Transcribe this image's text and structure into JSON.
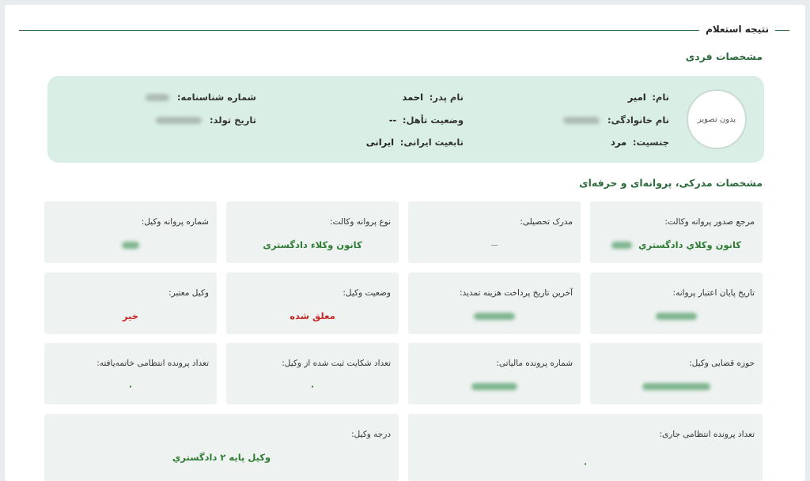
{
  "header": {
    "title": "نتیجه استعلام"
  },
  "personal": {
    "section_title": "مشخصات فردی",
    "avatar_text": "بدون تصویر",
    "first_name_label": "نام:",
    "first_name": "امیر",
    "last_name_label": "نام خانوادگی:",
    "gender_label": "جنسیت:",
    "gender": "مرد",
    "father_label": "نام پدر:",
    "father": "احمد",
    "marital_label": "وضعیت تأهل:",
    "marital": "--",
    "nationality_label": "تابعیت ایرانی:",
    "nationality": "ایرانی",
    "id_number_label": "شماره شناسنامه:",
    "birth_date_label": "تاریخ تولد:"
  },
  "professional": {
    "section_title": "مشخصات مدرکی، پروانه‌ای و حرفه‌ای",
    "cards": [
      {
        "label": "مرجع صدور پروانه وکالت:",
        "value": "كانون وكلاي دادگستري"
      },
      {
        "label": "مدرک تحصیلی:",
        "value": ""
      },
      {
        "label": "نوع پروانه وکالت:",
        "value": "کانون وکلاء دادگستری"
      },
      {
        "label": "شماره پروانه وکیل:",
        "value": ""
      },
      {
        "label": "تاریخ پایان اعتبار پروانه:",
        "value": ""
      },
      {
        "label": "آخرین تاریخ پرداخت هزینه تمدید:",
        "value": ""
      },
      {
        "label": "وضعیت وکیل:",
        "value": "معلق شده"
      },
      {
        "label": "وکیل معتبر:",
        "value": "خیر"
      },
      {
        "label": "حوزه قضایی وکیل:",
        "value": ""
      },
      {
        "label": "شماره پرونده مالیاتی:",
        "value": ""
      },
      {
        "label": "تعداد شکایت ثبت شده از وکیل:",
        "value": "۰"
      },
      {
        "label": "تعداد پرونده انتظامی خاتمه‌یافته:",
        "value": "۰"
      },
      {
        "label": "تعداد پرونده انتظامی جاری:",
        "value": "۰"
      },
      {
        "label": "درجه وکیل:",
        "value": "وكيل پايه ۲ دادگستري"
      }
    ]
  },
  "colors": {
    "accent": "#2e6b3e",
    "value_green": "#2e7d32",
    "value_red": "#c62828",
    "panel_bg": "#d9eee5",
    "card_bg": "#eef2f1"
  }
}
